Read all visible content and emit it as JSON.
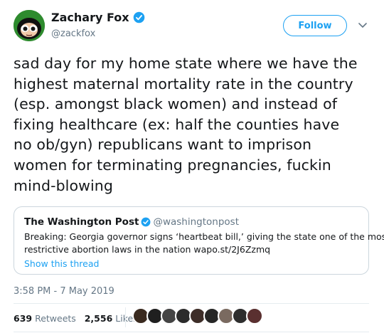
{
  "author": {
    "name": "Zachary Fox",
    "handle": "@zackfox",
    "avatar_icon": "powerpuff-girl-avatar",
    "verified_icon": "verified-badge-icon"
  },
  "follow_button": {
    "label": "Follow"
  },
  "menu_icon": "chevron-down-icon",
  "tweet": {
    "lines": [
      "sad day for my home state where we have the",
      "highest maternal mortality rate in the country",
      "(esp. amongst black women) and instead of",
      "fixing healthcare (ex: half the counties have",
      "no ob/gyn) republicans want to imprison",
      "women for terminating pregnancies, fuckin",
      "mind-blowing"
    ]
  },
  "quoted_tweet": {
    "name": "The Washington Post",
    "handle": "@washingtonpost",
    "lines": [
      "Breaking: Georgia governor signs ‘heartbeat bill,’ giving the state one of the most",
      "restrictive abortion laws in the nation wapo.st/2J6Zzmq"
    ],
    "show_thread": "Show this thread"
  },
  "timestamp": "3:58 PM - 7 May 2019",
  "stats": {
    "retweets_count": "639",
    "retweets_label": "Retweets",
    "likes_count": "2,556",
    "likes_label": "Likes"
  },
  "likers": {
    "colors": [
      "#3a2a1f",
      "#1f1f1f",
      "#444444",
      "#2b2b2b",
      "#3d2d28",
      "#262626",
      "#7a6a60",
      "#2e2e2e",
      "#5a3030"
    ]
  },
  "colors": {
    "accent": "#1da1f2",
    "text": "#14171a",
    "secondary": "#657786",
    "border": "#ccd6dd"
  }
}
